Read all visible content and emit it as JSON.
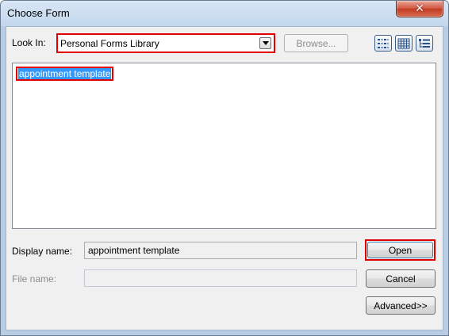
{
  "window": {
    "title": "Choose Form",
    "close_glyph": "✕"
  },
  "lookin": {
    "label": "Look In:",
    "value": "Personal Forms Library"
  },
  "toolbar": {
    "browse_label": "Browse..."
  },
  "view_icons": [
    "list-view-icon",
    "details-view-icon",
    "tree-view-icon"
  ],
  "list": {
    "items": [
      "appointment template"
    ]
  },
  "fields": {
    "display_name_label": "Display name:",
    "display_name_value": "appointment template",
    "file_name_label": "File name:",
    "file_name_value": ""
  },
  "buttons": {
    "open": "Open",
    "cancel": "Cancel",
    "advanced": "Advanced>>"
  },
  "colors": {
    "highlight_border": "#e30000",
    "selection": "#3399ff"
  }
}
